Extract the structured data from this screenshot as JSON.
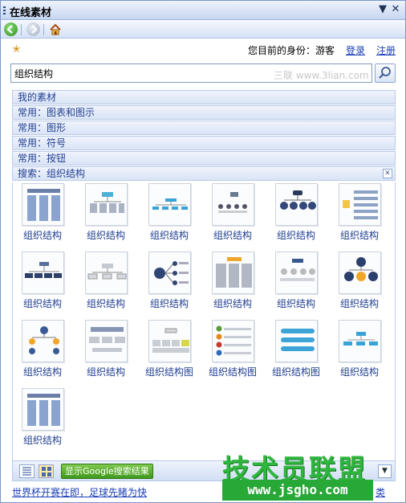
{
  "window": {
    "title": "在线素材"
  },
  "identity": {
    "text": "您目前的身份：游客",
    "login": "登录",
    "register": "注册"
  },
  "search": {
    "value": "组织结构",
    "watermark": "三联 www.3lian.com"
  },
  "categories": [
    {
      "label": "我的素材"
    },
    {
      "label": "常用：图表和图示"
    },
    {
      "label": "常用：图形"
    },
    {
      "label": "常用：符号"
    },
    {
      "label": "常用：按钮"
    },
    {
      "label": "搜索：组织结构"
    }
  ],
  "gallery": {
    "items": [
      {
        "label": "组织结构",
        "style": "columns"
      },
      {
        "label": "组织结构",
        "style": "tree-boxes"
      },
      {
        "label": "组织结构",
        "style": "wide-tree"
      },
      {
        "label": "组织结构",
        "style": "people"
      },
      {
        "label": "组织结构",
        "style": "dark-nodes"
      },
      {
        "label": "组织结构",
        "style": "list"
      },
      {
        "label": "组织结构",
        "style": "dark-bars"
      },
      {
        "label": "组织结构",
        "style": "gray-tree"
      },
      {
        "label": "组织结构",
        "style": "radial"
      },
      {
        "label": "组织结构",
        "style": "panels"
      },
      {
        "label": "组织结构",
        "style": "spheres"
      },
      {
        "label": "组织结构",
        "style": "circles"
      },
      {
        "label": "组织结构",
        "style": "ball-tree"
      },
      {
        "label": "组织结构",
        "style": "gray-panels"
      },
      {
        "label": "组织结构图",
        "style": "block-grid"
      },
      {
        "label": "组织结构图",
        "style": "bullets"
      },
      {
        "label": "组织结构图",
        "style": "blue-bars"
      },
      {
        "label": "组织结构",
        "style": "simple-tree"
      },
      {
        "label": "组织结构",
        "style": "columns"
      }
    ]
  },
  "bottombar": {
    "google_label": "显示Google搜索结果"
  },
  "footer": {
    "link": "世界杯开赛在即，足球先睹为快",
    "right_link": "类"
  },
  "overlay": {
    "brand": "技术员联盟",
    "url": "www.jsgho.com"
  },
  "colors": {
    "accent": "#1f3e90",
    "link": "#1a3fb5",
    "header_bg": "#d9e4f6",
    "watermark_green": "#2fb63e"
  }
}
